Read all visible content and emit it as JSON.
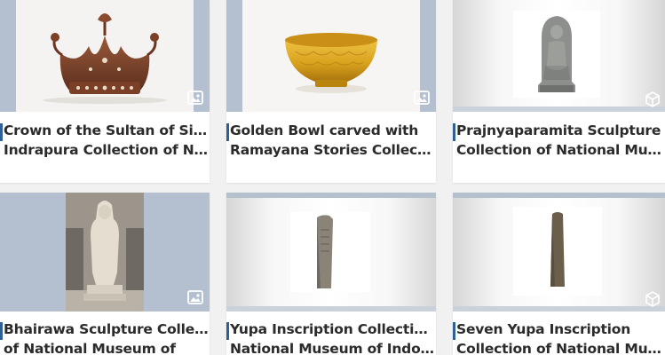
{
  "cards": [
    {
      "title_line1": "Crown of the Sultan of Siak Sri",
      "title_line2": "Indrapura Collection of Natio…",
      "badge_icon": "image-icon"
    },
    {
      "title_line1": "Golden Bowl carved with",
      "title_line2": "Ramayana Stories Collection…",
      "badge_icon": "image-icon"
    },
    {
      "title_line1": "Prajnyaparamita Sculpture",
      "title_line2": "Collection of National Museu…",
      "badge_icon": "3d-object-icon"
    },
    {
      "title_line1": "Bhairawa Sculpture Collection",
      "title_line2": "of National Museum of",
      "badge_icon": "image-icon"
    },
    {
      "title_line1": "Yupa Inscription Collection of",
      "title_line2": "National Museum of Indones…",
      "badge_icon": "3d-object-icon"
    },
    {
      "title_line1": "Seven Yupa Inscription",
      "title_line2": "Collection of National Museu…",
      "badge_icon": "3d-object-icon"
    }
  ],
  "colors": {
    "accent_bar": "#2f5f97",
    "thumb_border": "#b4c0d0",
    "background": "#f1f1f1"
  }
}
